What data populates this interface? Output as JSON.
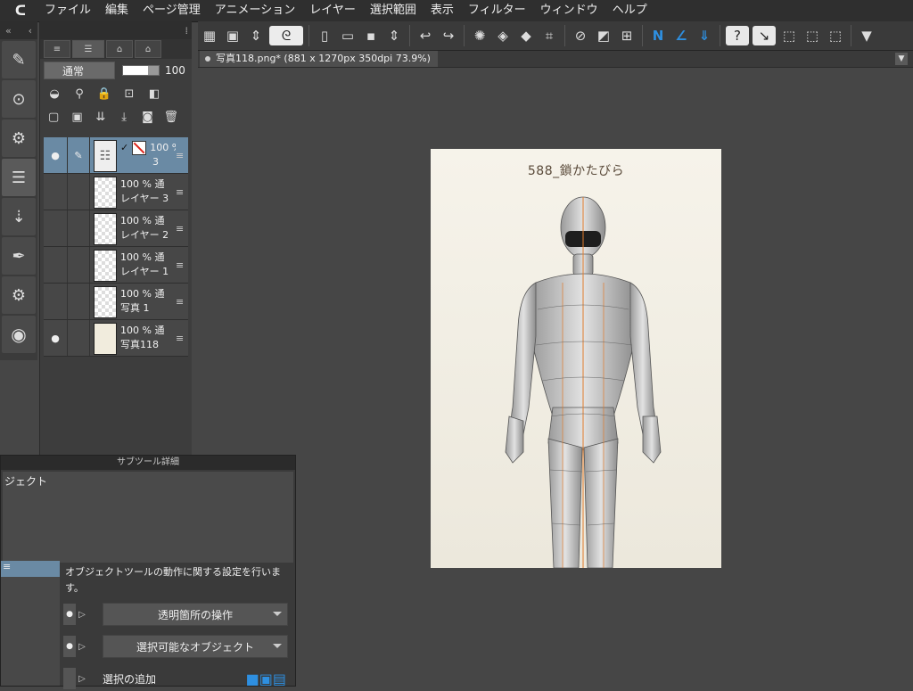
{
  "menu": {
    "logo_glyph": "ᑕ",
    "items": [
      "ファイル",
      "編集",
      "ページ管理",
      "アニメーション",
      "レイヤー",
      "選択範囲",
      "表示",
      "フィルター",
      "ウィンドウ",
      "ヘルプ"
    ]
  },
  "document": {
    "tab_label": "写真118.png* (881 x 1270px 350dpi 73.9%)"
  },
  "canvas": {
    "title": "588_鎖かたびら"
  },
  "layer_panel": {
    "blend_mode": "通常",
    "opacity": "100",
    "layers": [
      {
        "opacity": "100 %",
        "blend": "",
        "name": "3",
        "selected": true,
        "visible": true
      },
      {
        "opacity": "100 % 通",
        "name": "レイヤー 3",
        "selected": false,
        "visible": false
      },
      {
        "opacity": "100 % 通",
        "name": "レイヤー 2",
        "selected": false,
        "visible": false
      },
      {
        "opacity": "100 % 通",
        "name": "レイヤー 1",
        "selected": false,
        "visible": false
      },
      {
        "opacity": "100 % 通",
        "name": "写真 1",
        "selected": false,
        "visible": false
      },
      {
        "opacity": "100 % 通",
        "name": "写真118",
        "selected": false,
        "visible": true
      }
    ]
  },
  "subtool": {
    "header": "サブツール詳細",
    "top_label": "ジェクト",
    "left_item": "≡",
    "description": "オブジェクトツールの動作に関する設定を行います。",
    "rows": [
      {
        "label": "透明箇所の操作"
      },
      {
        "label": "選択可能なオブジェクト"
      },
      {
        "label": "選択の追加"
      }
    ]
  },
  "icons": {
    "accent_blue": "#2e8fe0",
    "selected_layer": "#6a8aa4"
  }
}
